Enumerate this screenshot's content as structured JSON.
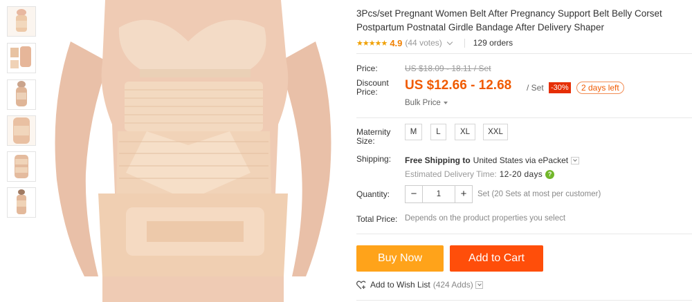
{
  "thumbnails": [
    {
      "icon": "product-thumbnail"
    },
    {
      "icon": "product-thumbnail"
    },
    {
      "icon": "product-thumbnail"
    },
    {
      "icon": "product-thumbnail"
    },
    {
      "icon": "product-thumbnail"
    },
    {
      "icon": "product-thumbnail"
    }
  ],
  "product": {
    "title": "3Pcs/set Pregnant Women Belt After Pregnancy Support Belt Belly Corset Postpartum Postnatal Girdle Bandage After Delivery Shaper",
    "rating": "4.9",
    "votes": "(44 votes)",
    "orders": "129 orders",
    "stars": "★★★★★"
  },
  "price": {
    "price_label": "Price:",
    "original": "US $18.09 - 18.11 / Set",
    "discount_label": "Discount Price:",
    "discount_label_line1": "Discount",
    "discount_label_line2": "Price:",
    "discounted": "US $12.66 - 12.68",
    "unit": "/ Set",
    "off": "-30%",
    "time_left": "2 days left",
    "bulk": "Bulk Price"
  },
  "options": {
    "size_label_line1": "Maternity",
    "size_label_line2": "Size:",
    "sizes": [
      "M",
      "L",
      "XL",
      "XXL"
    ]
  },
  "shipping": {
    "label": "Shipping:",
    "prefix": "Free Shipping to",
    "destination": "United States via ePacket",
    "estimated_label": "Estimated Delivery Time:",
    "estimated_days": "12-20 days"
  },
  "quantity": {
    "label": "Quantity:",
    "value": "1",
    "minus": "−",
    "plus": "+",
    "note": "Set (20 Sets at most per customer)"
  },
  "total": {
    "label": "Total Price:",
    "note": "Depends on the product properties you select"
  },
  "actions": {
    "buy_now": "Buy Now",
    "add_to_cart": "Add to Cart",
    "wishlist": "Add to Wish List",
    "wishlist_count": "(424 Adds)"
  },
  "colors": {
    "accent": "#f05a00",
    "buy_now": "#ffa31a",
    "add_to_cart": "#ff4e0a",
    "star": "#f0a000",
    "badge": "#e62e04",
    "help": "#72b72a"
  }
}
